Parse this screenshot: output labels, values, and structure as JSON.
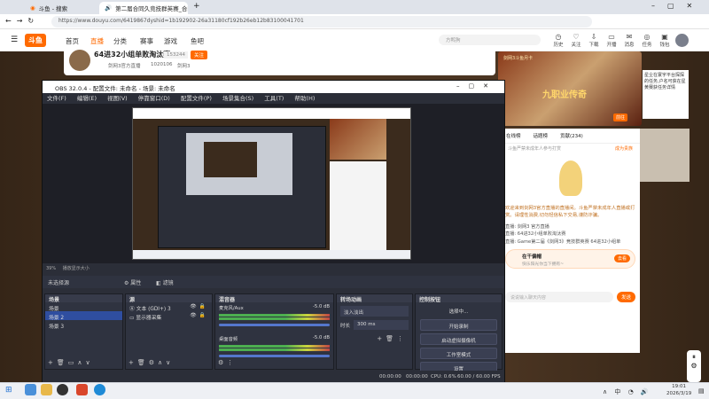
{
  "browser": {
    "tabs": [
      {
        "label": "斗鱼 - 搜索"
      },
      {
        "label": "第二届合同久竞技群英赛_合同"
      }
    ],
    "new_tab": "+",
    "url": "https://www.douyu.com/6419867dyshid=1b192902-26a31180cf192b26eb12b83100041701"
  },
  "site": {
    "logo": "斗鱼",
    "nav": [
      "首页",
      "直播",
      "分类",
      "赛事",
      "游戏",
      "鱼吧"
    ],
    "search_placeholder": "方鸭狗",
    "right_icons": [
      "历史",
      "关注",
      "下载",
      "开播",
      "消息",
      "任务",
      "任务",
      "钱包"
    ],
    "room_title": "64进32小组单败淘汰赛",
    "room_id": "153244",
    "follow": "关注",
    "owner": "剑网3官方直播",
    "fans": "1020106",
    "tag": "剑网3"
  },
  "banner": {
    "title": "九职业传奇",
    "sub": "剑网3斗鱼月卡",
    "desc": "星尘在寰宇平台探探的任务,户名可获在星黄赛获任务详情",
    "btn": "前往"
  },
  "chat": {
    "tabs": [
      "在线榜",
      "话题榜",
      "贡献(234)",
      "贵宾(24)"
    ],
    "rank_label": "斗鱼严禁未成年人参与打赏",
    "badge": "成为贵族",
    "welcome": "欢迎来到剑网3官方直播的直播间。斗鱼严禁未成年人直播或打赏。请理性消费,切勿轻信私下交易,谨防诈骗。",
    "msgs": [
      "直播: 剑网3 官方直播",
      "直播: 64进32小组单败淘汰赛",
      "直播: Game第二届《剑网3》竞技群英赛 64进32小组单"
    ],
    "gift_user": "在干偏帽",
    "gift_desc": "快乐阳光你当下拥有~",
    "gift_btn": "去看",
    "input_placeholder": "说说输入聊天内容",
    "send": "发送"
  },
  "obs": {
    "title": "OBS 32.0.4 - 配置文件: 未命名 - 场景: 未命名",
    "menu": [
      "文件(F)",
      "编辑(E)",
      "视图(V)",
      "停靠窗口(D)",
      "配置文件(P)",
      "场景集合(S)",
      "工具(T)",
      "帮助(H)"
    ],
    "zoom": "39%",
    "zoom_label": "播放显示大小",
    "no_source": "未选择源",
    "props": "属性",
    "filters": "滤镜",
    "panels": {
      "scenes": {
        "title": "场景",
        "items": [
          "场景",
          "场景 2",
          "场景 3"
        ]
      },
      "sources": {
        "title": "源",
        "items": [
          "文本 (GDI+) 3",
          "显示器采集"
        ]
      },
      "mixer": {
        "title": "混音器",
        "tracks": [
          {
            "name": "麦克风/Aux",
            "db": "-5.0 dB"
          },
          {
            "name": "桌面音频",
            "db": "-5.0 dB"
          }
        ]
      },
      "transitions": {
        "title": "转场动画",
        "type": "淡入淡出",
        "duration_label": "时长",
        "duration": "300 ms"
      },
      "controls": {
        "title": "控制按钮",
        "buttons": [
          "选择中...",
          "开始录制",
          "启动虚拟摄像机",
          "工作室模式",
          "设置"
        ]
      }
    },
    "status": {
      "time1": "00:00:00",
      "time2": "00:00:00",
      "cpu": "CPU: 0.6%",
      "fps": "60.00 / 60.00 FPS"
    }
  },
  "taskbar": {
    "time": "19:01",
    "date": "2026/3/19",
    "lang": "中"
  },
  "colors": {
    "douyu_orange": "#ff6a00",
    "obs_bg": "#2b2e38",
    "obs_select": "#2f4ea0",
    "meter_green": "#4caf50"
  }
}
